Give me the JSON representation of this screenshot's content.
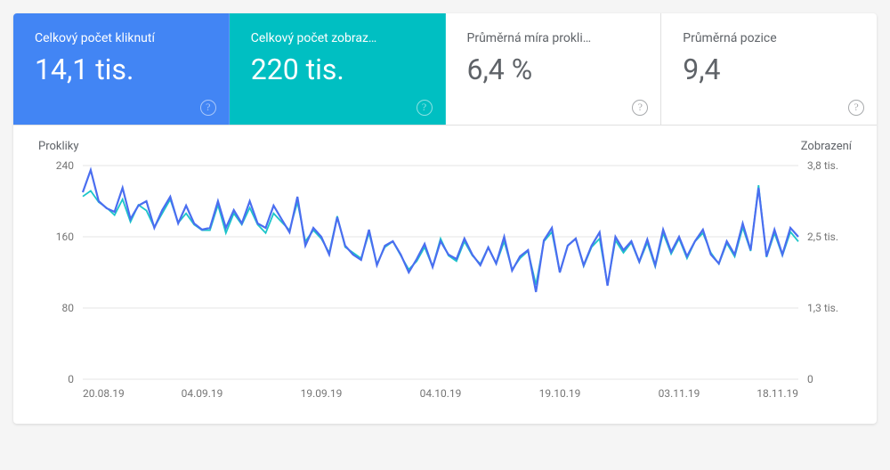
{
  "metrics": [
    {
      "key": "clicks",
      "label": "Celkový počet kliknutí",
      "value": "14,1 tis.",
      "color": "blue"
    },
    {
      "key": "impressions",
      "label": "Celkový počet zobraz…",
      "value": "220 tis.",
      "color": "teal"
    },
    {
      "key": "ctr",
      "label": "Průměrná míra prokli…",
      "value": "6,4 %",
      "color": "white"
    },
    {
      "key": "position",
      "label": "Průměrná pozice",
      "value": "9,4",
      "color": "white"
    }
  ],
  "chart": {
    "left_axis_title": "Prokliky",
    "right_axis_title": "Zobrazení",
    "left_ticks": [
      "240",
      "160",
      "80",
      "0"
    ],
    "right_ticks": [
      "3,8 tis.",
      "2,5 tis.",
      "1,3 tis.",
      "0"
    ],
    "x_ticks": [
      "20.08.19",
      "04.09.19",
      "19.09.19",
      "04.10.19",
      "19.10.19",
      "03.11.19",
      "18.11.19"
    ]
  },
  "chart_data": {
    "type": "line",
    "title": "",
    "xlabel": "",
    "left_axis": {
      "label": "Prokliky",
      "range": [
        0,
        240
      ]
    },
    "right_axis": {
      "label": "Zobrazení",
      "range": [
        0,
        3800
      ]
    },
    "x_dates": [
      "20.08.19",
      "21.08.19",
      "22.08.19",
      "23.08.19",
      "24.08.19",
      "25.08.19",
      "26.08.19",
      "27.08.19",
      "28.08.19",
      "29.08.19",
      "30.08.19",
      "31.08.19",
      "01.09.19",
      "02.09.19",
      "03.09.19",
      "04.09.19",
      "05.09.19",
      "06.09.19",
      "07.09.19",
      "08.09.19",
      "09.09.19",
      "10.09.19",
      "11.09.19",
      "12.09.19",
      "13.09.19",
      "14.09.19",
      "15.09.19",
      "16.09.19",
      "17.09.19",
      "18.09.19",
      "19.09.19",
      "20.09.19",
      "21.09.19",
      "22.09.19",
      "23.09.19",
      "24.09.19",
      "25.09.19",
      "26.09.19",
      "27.09.19",
      "28.09.19",
      "29.09.19",
      "30.09.19",
      "01.10.19",
      "02.10.19",
      "03.10.19",
      "04.10.19",
      "05.10.19",
      "06.10.19",
      "07.10.19",
      "08.10.19",
      "09.10.19",
      "10.10.19",
      "11.10.19",
      "12.10.19",
      "13.10.19",
      "14.10.19",
      "15.10.19",
      "16.10.19",
      "17.10.19",
      "18.10.19",
      "19.10.19",
      "20.10.19",
      "21.10.19",
      "22.10.19",
      "23.10.19",
      "24.10.19",
      "25.10.19",
      "26.10.19",
      "27.10.19",
      "28.10.19",
      "29.10.19",
      "30.10.19",
      "31.10.19",
      "01.11.19",
      "02.11.19",
      "03.11.19",
      "04.11.19",
      "05.11.19",
      "06.11.19",
      "07.11.19",
      "08.11.19",
      "09.11.19",
      "10.11.19",
      "11.11.19",
      "12.11.19",
      "13.11.19",
      "14.11.19",
      "15.11.19",
      "16.11.19",
      "17.11.19",
      "18.11.19"
    ],
    "series": [
      {
        "name": "Prokliky",
        "axis": "left",
        "color": "#4a6ef0",
        "values": [
          210,
          235,
          200,
          192,
          188,
          215,
          180,
          195,
          200,
          170,
          190,
          205,
          175,
          195,
          175,
          168,
          170,
          200,
          170,
          190,
          175,
          200,
          175,
          170,
          195,
          180,
          165,
          205,
          150,
          170,
          160,
          140,
          182,
          150,
          140,
          134,
          168,
          128,
          150,
          155,
          140,
          120,
          135,
          152,
          126,
          155,
          140,
          135,
          158,
          140,
          128,
          148,
          130,
          160,
          122,
          138,
          145,
          98,
          156,
          170,
          120,
          150,
          158,
          128,
          150,
          165,
          105,
          160,
          145,
          155,
          132,
          157,
          128,
          168,
          143,
          160,
          138,
          155,
          168,
          140,
          130,
          155,
          140,
          175,
          145,
          215,
          138,
          168,
          140,
          170,
          160
        ]
      },
      {
        "name": "Zobrazení",
        "axis": "right",
        "color": "#1cc5c9",
        "values": [
          3250,
          3350,
          3150,
          3050,
          2920,
          3200,
          2800,
          3100,
          3000,
          2700,
          2950,
          3200,
          2780,
          2950,
          2750,
          2650,
          2650,
          3100,
          2600,
          2950,
          2750,
          3050,
          2750,
          2600,
          2950,
          2800,
          2650,
          3150,
          2450,
          2650,
          2500,
          2250,
          2900,
          2350,
          2250,
          2150,
          2600,
          2050,
          2350,
          2450,
          2200,
          1950,
          2100,
          2350,
          2000,
          2500,
          2200,
          2100,
          2450,
          2200,
          2050,
          2350,
          2050,
          2450,
          1950,
          2150,
          2280,
          1680,
          2450,
          2620,
          1900,
          2380,
          2500,
          2010,
          2350,
          2500,
          1680,
          2470,
          2250,
          2430,
          2080,
          2430,
          2000,
          2600,
          2230,
          2500,
          2150,
          2450,
          2600,
          2250,
          2050,
          2420,
          2180,
          2700,
          2280,
          3450,
          2170,
          2600,
          2200,
          2620,
          2450
        ]
      }
    ]
  }
}
